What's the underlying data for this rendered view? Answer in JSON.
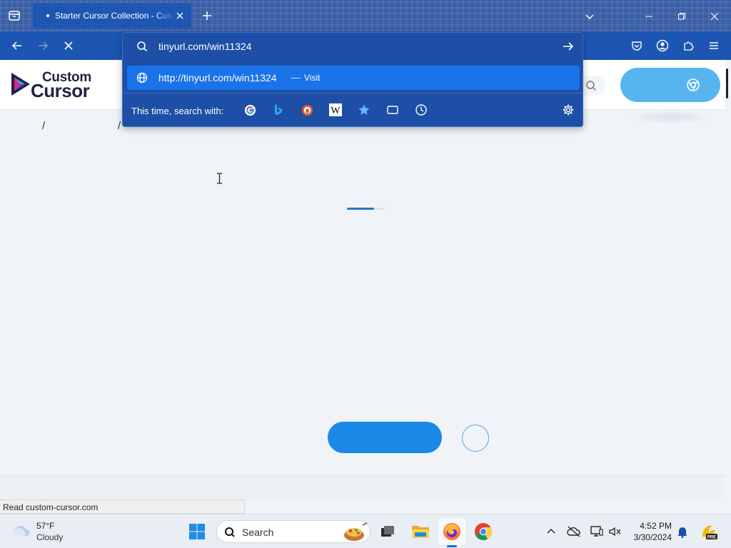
{
  "browser": {
    "tab": {
      "title": "Starter Cursor Collection - Custom Cursor"
    },
    "address": {
      "value": "tinyurl.com/win11324",
      "suggestion_url": "http://tinyurl.com/win11324",
      "suggestion_sep": "—",
      "suggestion_action": "Visit",
      "search_with_label": "This time, search with:"
    },
    "status_text": "Read custom-cursor.com"
  },
  "page": {
    "logo_line1": "Custom",
    "logo_line2": "Cursor",
    "breadcrumb_sep1": "/",
    "breadcrumb_sep2": "/"
  },
  "taskbar": {
    "weather_temp": "57°F",
    "weather_condition": "Cloudy",
    "search_label": "Search",
    "time": "4:52 PM",
    "date": "3/30/2024"
  },
  "colors": {
    "tabstrip": "#3a5fa6",
    "navbar": "#1c55b2",
    "suggestion_highlight": "#1a73e8",
    "cta_light": "#56b5ef",
    "cta_primary": "#1a88e6"
  }
}
